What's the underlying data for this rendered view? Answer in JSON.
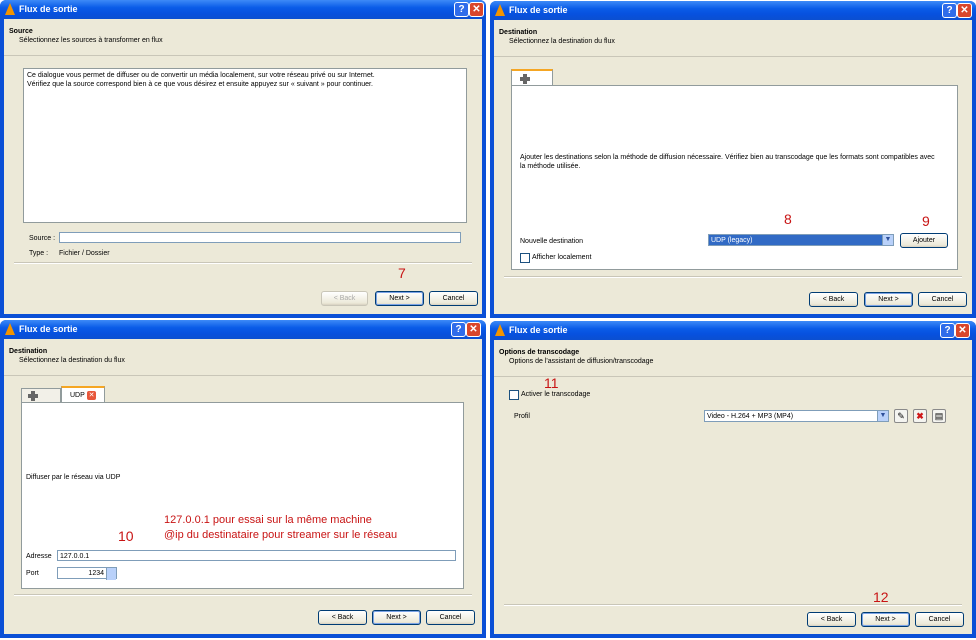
{
  "windows": [
    {
      "title": "Flux de sortie",
      "header": "Source",
      "subheader": "Sélectionnez les sources à transformer en flux"
    },
    {
      "title": "Flux de sortie",
      "header": "Destination",
      "subheader": "Sélectionnez la destination du flux"
    },
    {
      "title": "Flux de sortie",
      "header": "Destination",
      "subheader": "Sélectionnez la destination du flux"
    },
    {
      "title": "Flux de sortie",
      "header": "Options de transcodage",
      "subheader": "Options de l'assistant de diffusion/transcodage"
    }
  ],
  "titlebar_buttons": {
    "help": "?",
    "close": "✕"
  },
  "buttons": {
    "back": "< Back",
    "next": "Next >",
    "cancel": "Cancel",
    "add": "Ajouter"
  },
  "source": {
    "description_line1": "Ce dialogue vous permet de diffuser ou de convertir un média localement, sur votre réseau privé ou sur Internet.",
    "description_line2": "Vérifiez que la source correspond bien à ce que vous désirez et ensuite appuyez sur « suivant » pour continuer.",
    "source_label": "Source :",
    "source_value": "",
    "type_label": "Type :",
    "type_value": "Fichier / Dossier"
  },
  "destination": {
    "info": "Ajouter les destinations selon la méthode de diffusion nécessaire. Vérifiez bien au transcodage que les formats sont compatibles avec",
    "info2": "la méthode utilisée.",
    "new_dest_label": "Nouvelle destination",
    "new_dest_value": "UDP (legacy)",
    "show_local_label": "Afficher localement"
  },
  "udp": {
    "tab_label": "UDP",
    "info": "Diffuser par le réseau via UDP",
    "address_label": "Adresse",
    "address_value": "127.0.0.1",
    "port_label": "Port",
    "port_value": "1234"
  },
  "transcode": {
    "activate_label": "Activer le transcodage",
    "profile_label": "Profil",
    "profile_value": "Video - H.264 + MP3 (MP4)"
  },
  "annotations": {
    "n7": "7",
    "n8": "8",
    "n9": "9",
    "n10": "10",
    "n11": "11",
    "n12": "12",
    "note_line1": "127.0.0.1 pour essai sur la même machine",
    "note_line2": "@ip du destinataire pour streamer sur le réseau"
  },
  "colors": {
    "titlebar": "#0a5ce8",
    "annotation": "#c81414",
    "window_bg": "#ece9d8"
  }
}
